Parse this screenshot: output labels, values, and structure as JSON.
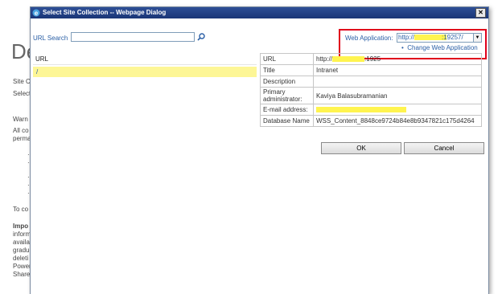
{
  "background": {
    "title": "De",
    "lines": [
      "Site C",
      "Select",
      "Warn",
      "All co",
      "perma",
      "To co",
      "Impo",
      "inform",
      "availa",
      "gradu",
      "deleti",
      "Power",
      "Share"
    ]
  },
  "dialog": {
    "title": "Select Site Collection -- Webpage Dialog",
    "close_glyph": "✕",
    "url_search_label": "URL Search",
    "url_search_value": "",
    "web_application_label": "Web Application:",
    "web_application_value": "http://",
    "web_application_suffix": ":19257/",
    "change_link": "Change Web Application",
    "list_header": "URL",
    "list_rows": [
      "/"
    ],
    "properties": {
      "url": {
        "label": "URL",
        "value": "http://",
        "suffix": ":1925"
      },
      "title": {
        "label": "Title",
        "value": "Intranet"
      },
      "description": {
        "label": "Description",
        "value": ""
      },
      "primary_admin": {
        "label": "Primary administrator:",
        "value": "Kaviya Balasubramanian"
      },
      "email": {
        "label": "E-mail address:",
        "value": ""
      },
      "database": {
        "label": "Database Name",
        "value": "WSS_Content_8848ce9724b84e8b9347821c175d4264"
      }
    },
    "ok_label": "OK",
    "cancel_label": "Cancel"
  },
  "colors": {
    "link": "#2a5fa6",
    "highlight": "#fff44f",
    "selection": "#fdf696",
    "callout": "#e0001b"
  }
}
